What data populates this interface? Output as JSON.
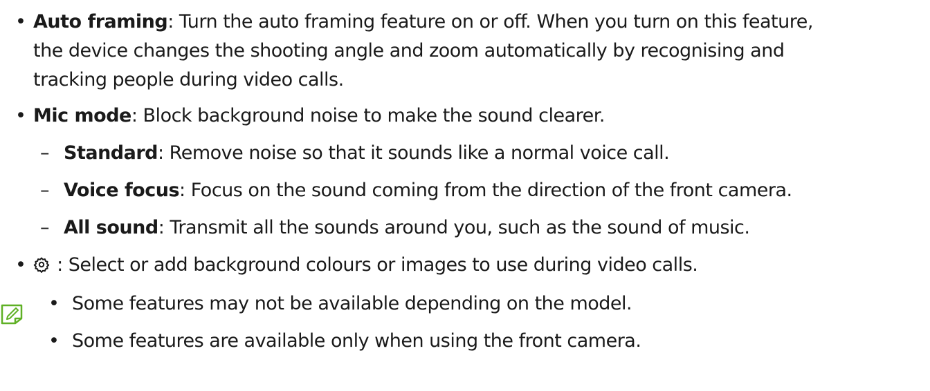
{
  "bullet_char": "•",
  "dash_char": "–",
  "items": [
    {
      "term": "Auto framing",
      "lines": [
        ": Turn the auto framing feature on or off. When you turn on this feature,",
        "the device changes the shooting angle and zoom automatically by recognising and",
        "tracking people during video calls."
      ]
    },
    {
      "term": "Mic mode",
      "text": ": Block background noise to make the sound clearer.",
      "subitems": [
        {
          "term": "Standard",
          "text": ": Remove noise so that it sounds like a normal voice call."
        },
        {
          "term": "Voice focus",
          "text": ": Focus on the sound coming from the direction of the front camera."
        },
        {
          "term": "All sound",
          "text": ": Transmit all the sounds around you, such as the sound of music."
        }
      ]
    },
    {
      "icon": "gear-icon",
      "text": " : Select or add background colours or images to use during video calls."
    }
  ],
  "note": {
    "icon": "note-pencil-icon",
    "accent": "#5fb025",
    "items": [
      "Some features may not be available depending on the model.",
      "Some features are available only when using the front camera."
    ]
  }
}
